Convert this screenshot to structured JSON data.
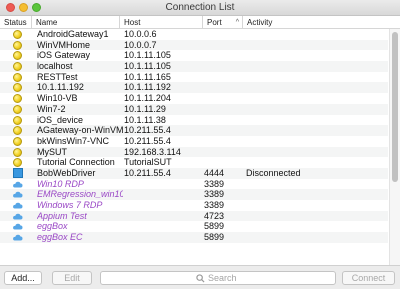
{
  "window": {
    "title": "Connection List"
  },
  "columns": {
    "status": "Status",
    "name": "Name",
    "host": "Host",
    "port": "Port",
    "activity": "Activity"
  },
  "rows": [
    {
      "status_icon": "yellow-circle",
      "name": "AndroidGateway1",
      "host": "10.0.0.6",
      "port": "",
      "activity": ""
    },
    {
      "status_icon": "yellow-circle",
      "name": "WinVMHome",
      "host": "10.0.0.7",
      "port": "",
      "activity": ""
    },
    {
      "status_icon": "yellow-circle",
      "name": "iOS Gateway",
      "host": "10.1.11.105",
      "port": "",
      "activity": ""
    },
    {
      "status_icon": "yellow-circle",
      "name": "localhost",
      "host": "10.1.11.105",
      "port": "",
      "activity": ""
    },
    {
      "status_icon": "yellow-circle",
      "name": "RESTTest",
      "host": "10.1.11.165",
      "port": "",
      "activity": ""
    },
    {
      "status_icon": "yellow-circle",
      "name": "10.1.11.192",
      "host": "10.1.11.192",
      "port": "",
      "activity": ""
    },
    {
      "status_icon": "yellow-circle",
      "name": "Win10-VB",
      "host": "10.1.11.204",
      "port": "",
      "activity": ""
    },
    {
      "status_icon": "yellow-circle",
      "name": "Win7-2",
      "host": "10.1.11.29",
      "port": "",
      "activity": ""
    },
    {
      "status_icon": "yellow-circle",
      "name": "iOS_device",
      "host": "10.1.11.38",
      "port": "",
      "activity": ""
    },
    {
      "status_icon": "yellow-circle",
      "name": "AGateway-on-WinVM1",
      "host": "10.211.55.4",
      "port": "",
      "activity": ""
    },
    {
      "status_icon": "yellow-circle",
      "name": "bkWinsWin7-VNC",
      "host": "10.211.55.4",
      "port": "",
      "activity": ""
    },
    {
      "status_icon": "yellow-circle",
      "name": "MySUT",
      "host": "192.168.3.114",
      "port": "",
      "activity": ""
    },
    {
      "status_icon": "yellow-circle",
      "name": "Tutorial Connection",
      "host": "TutorialSUT",
      "port": "",
      "activity": ""
    },
    {
      "status_icon": "blue-square",
      "name": "BobWebDriver",
      "host": "10.211.55.4",
      "port": "4444",
      "activity": "Disconnected"
    },
    {
      "status_icon": "cloud",
      "name": "Win10 RDP",
      "host": "",
      "port": "3389",
      "activity": ""
    },
    {
      "status_icon": "cloud",
      "name": "EMRegression_win10",
      "host": "",
      "port": "3389",
      "activity": ""
    },
    {
      "status_icon": "cloud",
      "name": "Windows 7 RDP",
      "host": "",
      "port": "3389",
      "activity": ""
    },
    {
      "status_icon": "cloud",
      "name": "Appium Test",
      "host": "",
      "port": "4723",
      "activity": ""
    },
    {
      "status_icon": "cloud",
      "name": "eggBox",
      "host": "",
      "port": "5899",
      "activity": ""
    },
    {
      "status_icon": "cloud",
      "name": "eggBox EC",
      "host": "",
      "port": "5899",
      "activity": ""
    }
  ],
  "toolbar": {
    "add_label": "Add...",
    "edit_label": "Edit",
    "connect_label": "Connect",
    "search_placeholder": "Search"
  },
  "colors": {
    "cloud_name": "#9a48c6",
    "status_yellow": "#f3d224",
    "status_blue": "#3a98e0",
    "cloud_icon": "#57a6e6"
  }
}
